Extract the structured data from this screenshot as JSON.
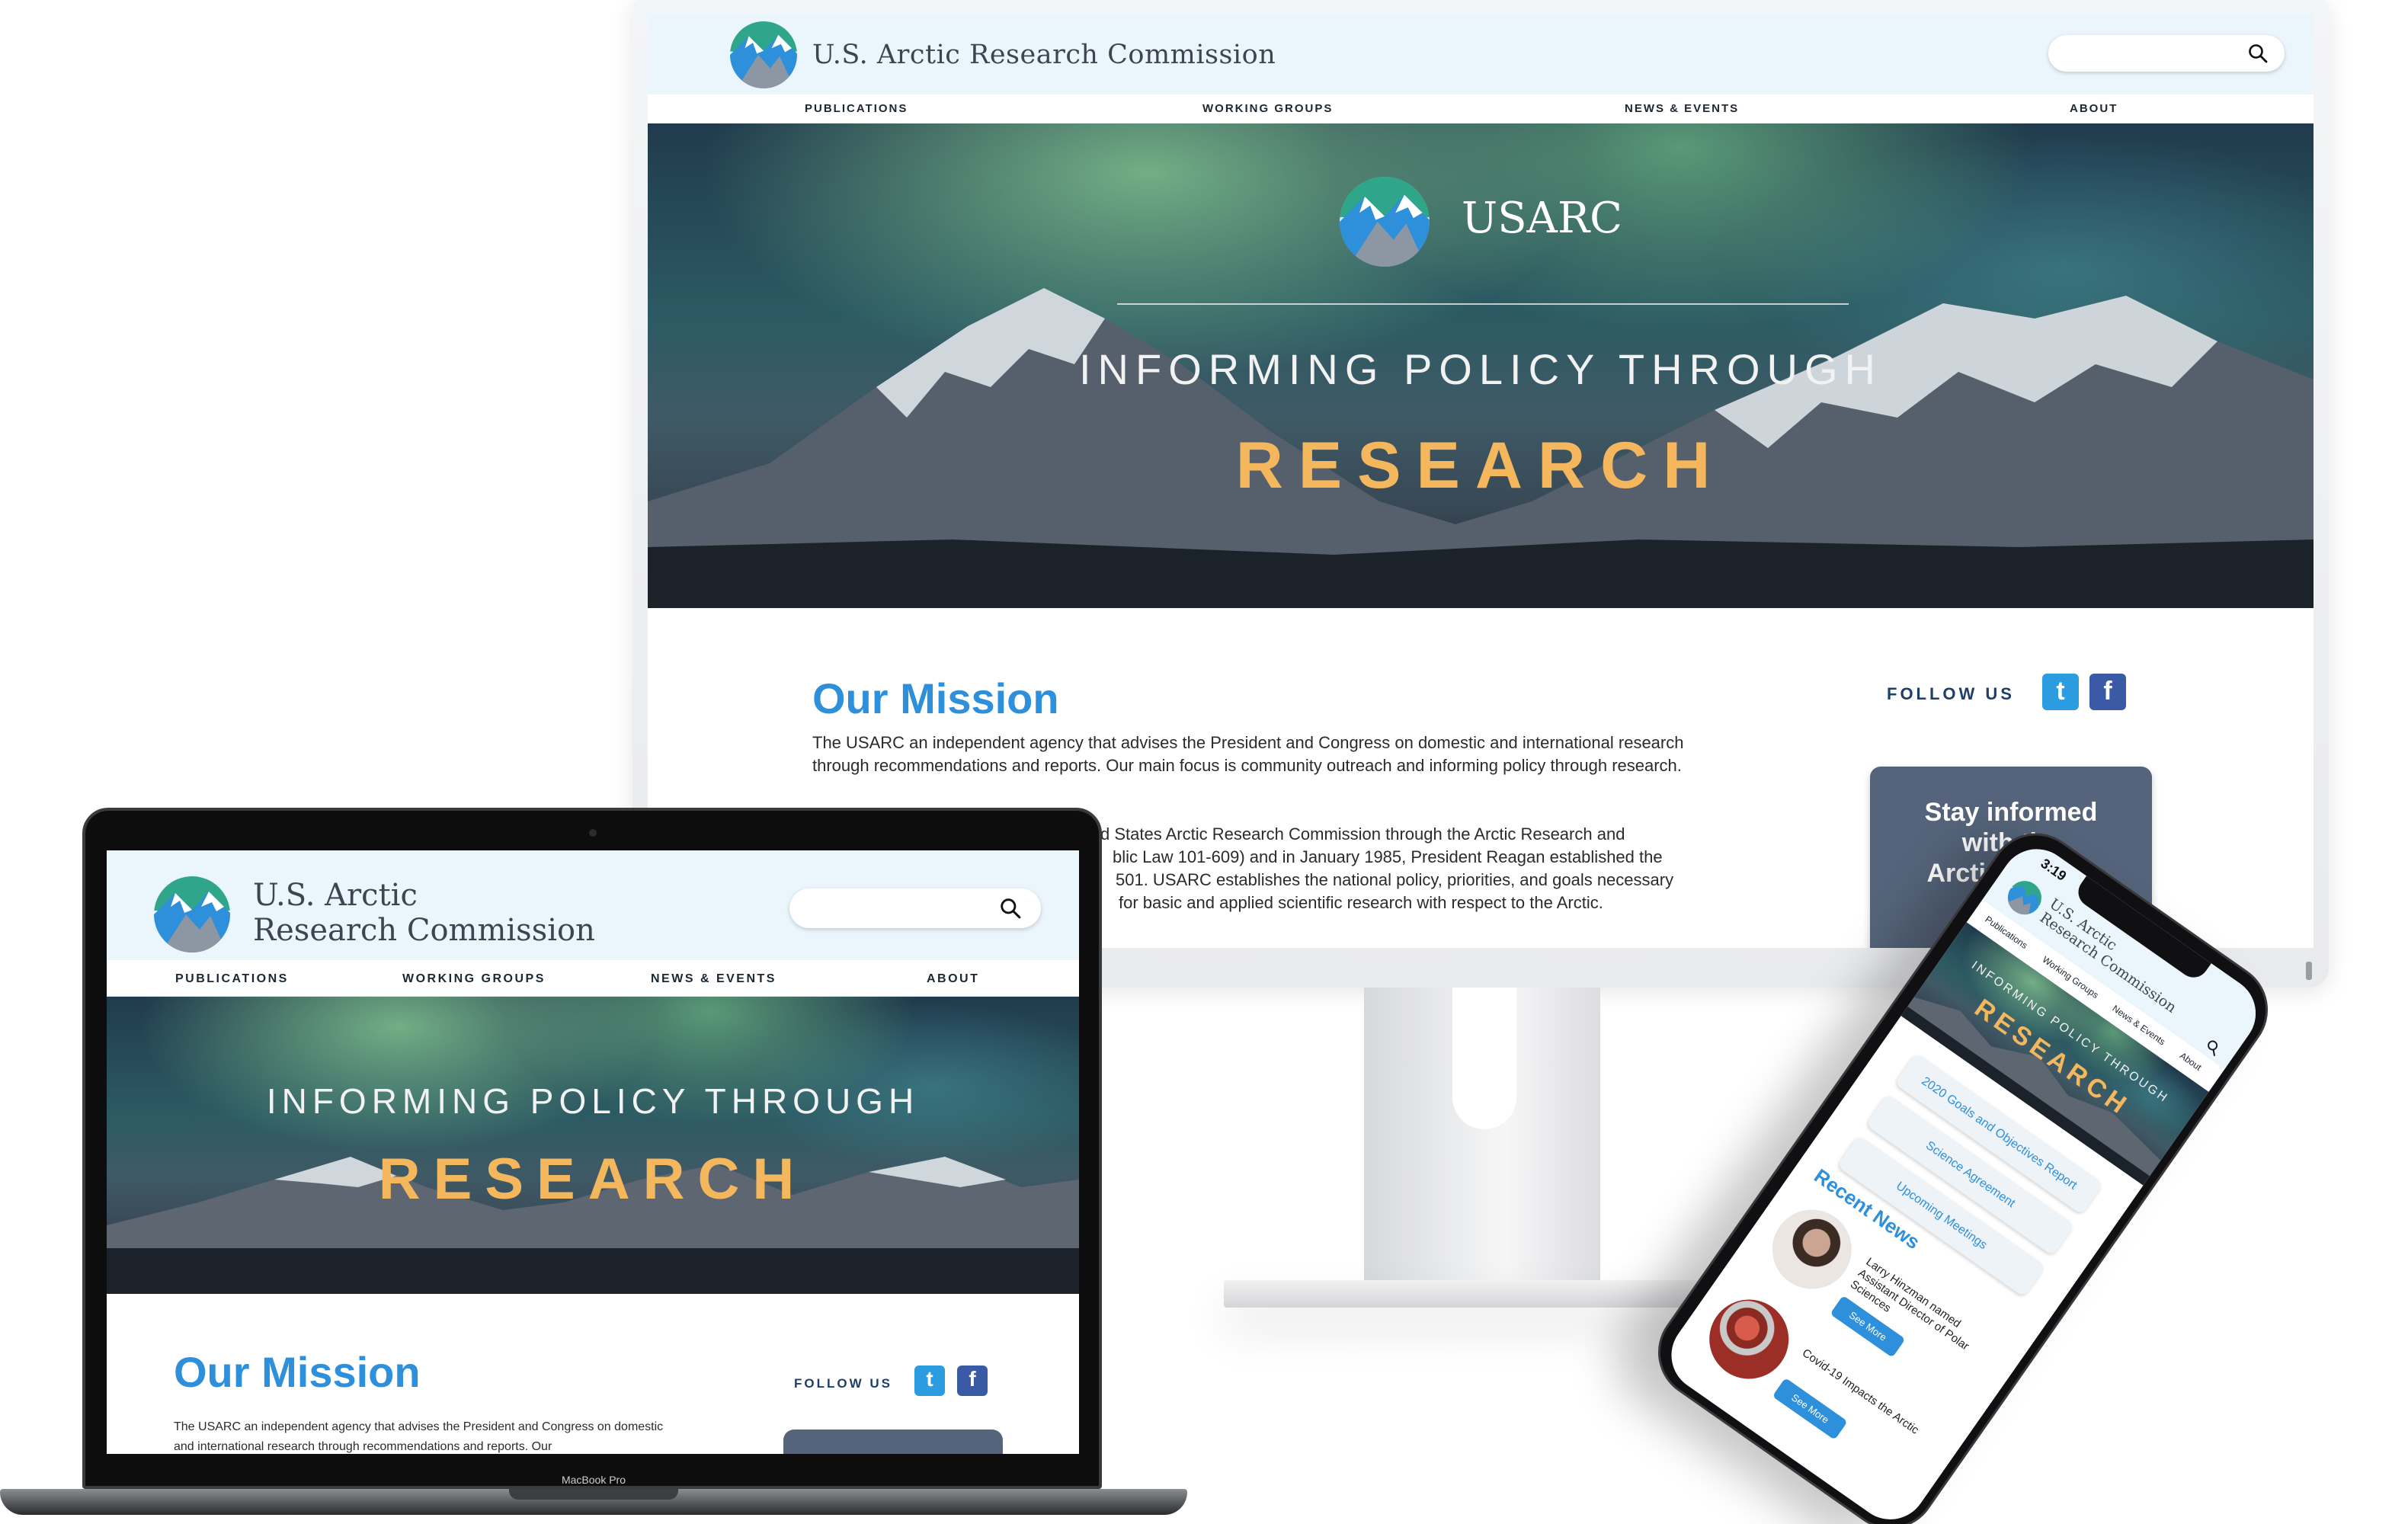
{
  "site": {
    "title": "U.S. Arctic Research Commission",
    "title_line1": "U.S. Arctic",
    "title_line2": "Research Commission",
    "phone_title_line1": "U.S. Arctic",
    "phone_title_line2": "Research Commission",
    "brand_short": "USARC"
  },
  "nav": {
    "items": [
      "PUBLICATIONS",
      "WORKING GROUPS",
      "NEWS & EVENTS",
      "ABOUT"
    ],
    "phone_items": [
      "Publications",
      "Working Groups",
      "News & Events",
      "About"
    ]
  },
  "hero": {
    "line1": "INFORMING POLICY THROUGH",
    "line2": "RESEARCH"
  },
  "mission": {
    "title": "Our Mission",
    "paragraph1": "The USARC an independent agency that advises the President and Congress on domestic and international research through recommendations and reports. Our main focus is community outreach and informing policy through research.",
    "paragraph2_fragment": "d States Arctic Research Commission through the Arctic Research and",
    "paragraph2_line2": "blic Law 101-609) and in January 1985, President Reagan established the",
    "paragraph2_line3": "501. USARC establishes the national policy, priorities, and goals necessary",
    "paragraph2_line4": "for basic and applied scientific research with respect to the Arctic."
  },
  "laptop_mission_text": "The USARC an independent agency that advises the President and Congress on domestic and international research through recommendations and reports. Our",
  "social": {
    "follow_label": "FOLLOW US",
    "twitter_glyph": "t",
    "facebook_glyph": "f"
  },
  "newsletter": {
    "line1": "Stay informed",
    "line2": "with the",
    "line3": "Arctic Update"
  },
  "phone": {
    "time": "3:19",
    "buttons": [
      "2020 Goals and Objectives Report",
      "Science Agreement",
      "Upcoming Meetings"
    ],
    "recent_news_title": "Recent News",
    "news": [
      {
        "text": "Larry Hinzman named Assistant Director of Polar Sciences",
        "cta": "See More"
      },
      {
        "text": "Covid-19 Impacts the Arctic",
        "cta": "See More"
      }
    ]
  },
  "device_label": "MacBook Pro",
  "colors": {
    "accent_blue": "#2e8fdb",
    "hero_gold": "#f4b75d",
    "header_bg": "#eaf6fc",
    "navy": "#1d3f6a",
    "newsletter_bg": "#55647a"
  }
}
